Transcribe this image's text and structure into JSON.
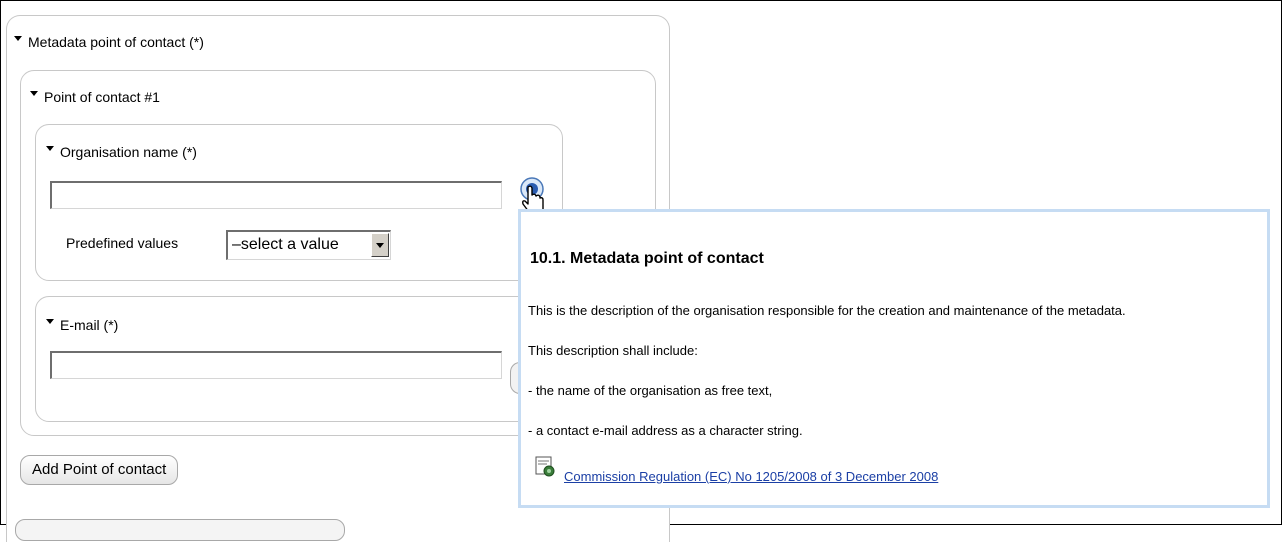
{
  "section": {
    "title": "Metadata point of contact (*)"
  },
  "contact": {
    "title": "Point of contact #1",
    "organisation": {
      "label": "Organisation name (*)",
      "value": "",
      "predefined_label": "Predefined values",
      "select_value": "–select a value"
    },
    "email": {
      "label": "E-mail (*)",
      "value": ""
    }
  },
  "add_button": "Add Point of contact",
  "tooltip": {
    "title": "10.1. Metadata point of contact",
    "paragraphs": [
      "This is the description of the organisation responsible for the creation and maintenance of the metadata.",
      "This description shall include:",
      "- the name of the organisation as free text,",
      "- a contact e-mail address as a character string."
    ],
    "link": "Commission Regulation (EC) No 1205/2008 of 3 December 2008"
  },
  "icons": [
    "help-globe-icon",
    "hand-cursor-icon",
    "document-link-icon",
    "triangle-down-icon"
  ]
}
